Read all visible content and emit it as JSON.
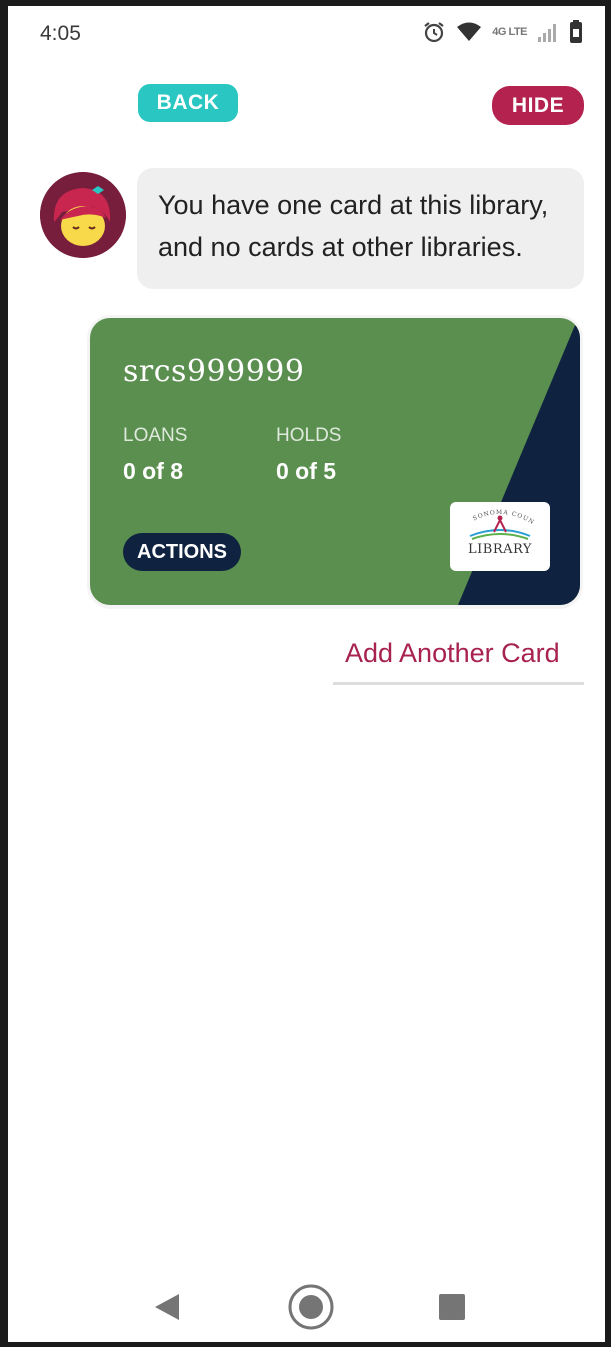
{
  "status_bar": {
    "time": "4:05",
    "network_label": "4G LTE",
    "icons": [
      "alarm-icon",
      "wifi-icon",
      "signal-icon",
      "battery-icon"
    ]
  },
  "toolbar": {
    "back_label": "BACK",
    "hide_label": "HIDE"
  },
  "message": {
    "line1": "You have one card at this library,",
    "line2": "and no cards at other libraries."
  },
  "card": {
    "number": "srcs999999",
    "loans_label": "LOANS",
    "loans_value": "0 of 8",
    "holds_label": "HOLDS",
    "holds_value": "0 of 5",
    "actions_label": "ACTIONS",
    "library_name": "LIBRARY",
    "library_arc_text": "SONOMA COUNTY",
    "colors": {
      "card_green": "#5a8f4f",
      "stripe_navy": "#0f2340"
    }
  },
  "add_card_label": "Add Another Card",
  "colors": {
    "back_teal": "#2ac6c2",
    "hide_magenta": "#b4224f",
    "link_magenta": "#a8224e"
  },
  "nav": {
    "icons": [
      "back-triangle-icon",
      "home-circle-icon",
      "recents-square-icon"
    ]
  }
}
